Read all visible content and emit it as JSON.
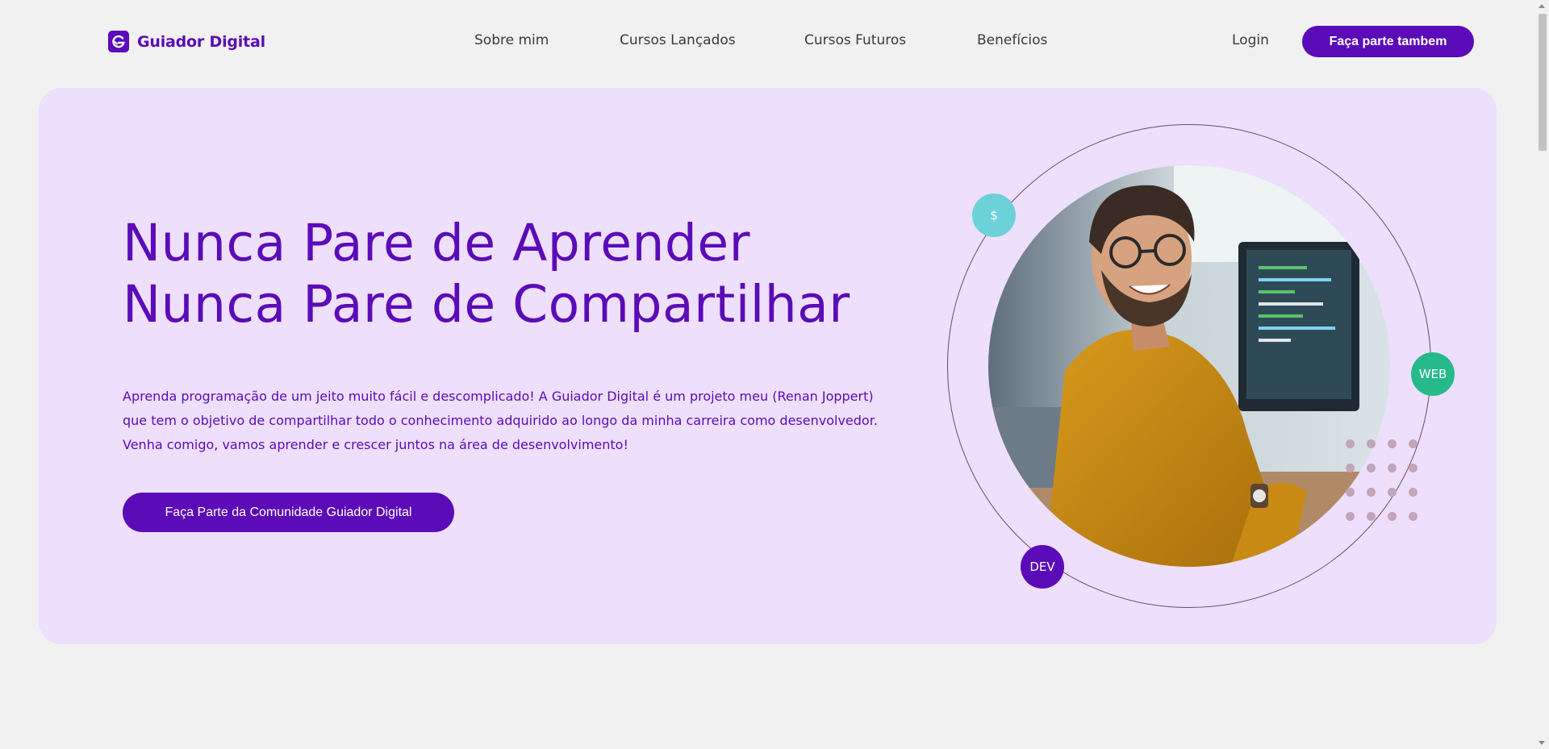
{
  "brand": {
    "name": "Guiador Digital",
    "primary_color": "#5b0bb8",
    "hero_bg_color": "#eedffd"
  },
  "nav": {
    "items": [
      "Sobre mim",
      "Cursos Lançados",
      "Cursos Futuros",
      "Benefícios"
    ],
    "login": "Login",
    "cta": "Faça parte tambem"
  },
  "hero": {
    "title_line1": "Nunca Pare de Aprender",
    "title_line2": "Nunca Pare de Compartilhar",
    "description": "Aprenda programação de um jeito muito fácil e descomplicado! A Guiador Digital é um projeto meu (Renan Joppert) que tem o objetivo de compartilhar todo o conhecimento adquirido ao longo da minha carreira como desenvolvedor. Venha comigo, vamos aprender e crescer juntos na área de desenvolvimento!",
    "cta": "Faça Parte da Comunidade Guiador Digital",
    "badges": {
      "dollar": "$",
      "web": "WEB",
      "dev": "DEV"
    },
    "badge_colors": {
      "dollar": "#6dd1d8",
      "web": "#26ba8a",
      "dev": "#5b0bb8"
    }
  }
}
